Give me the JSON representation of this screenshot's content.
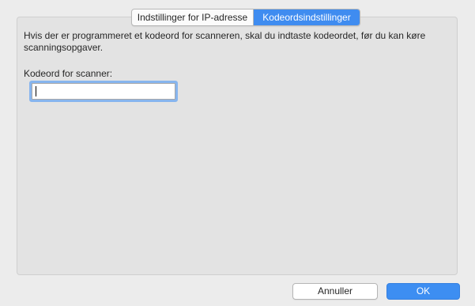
{
  "tabs": {
    "ip_label": "Indstillinger for IP-adresse",
    "password_label": "Kodeordsindstillinger",
    "selected": "Kodeordsindstillinger"
  },
  "content": {
    "description": "Hvis der er programmeret et kodeord for scanneren, skal du indtaste kodeordet, før du kan køre scanningsopgaver.",
    "field_label": "Kodeord for scanner:",
    "field_value": "",
    "field_placeholder": ""
  },
  "buttons": {
    "cancel_label": "Annuller",
    "ok_label": "OK"
  },
  "colors": {
    "accent": "#3f8cf0",
    "window_bg": "#ececec",
    "panel_bg": "#e3e3e3"
  }
}
